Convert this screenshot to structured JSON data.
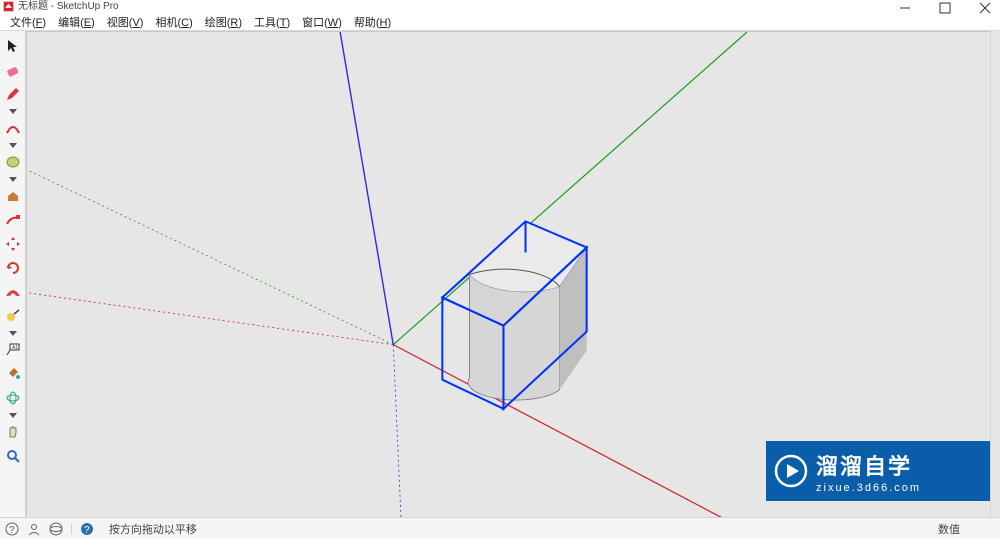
{
  "title": "无标题 - SketchUp Pro",
  "window_controls": {
    "min": "minimize",
    "max": "restore",
    "close": "close"
  },
  "menu": [
    {
      "label": "文件",
      "mn": "F"
    },
    {
      "label": "编辑",
      "mn": "E"
    },
    {
      "label": "视图",
      "mn": "V"
    },
    {
      "label": "相机",
      "mn": "C"
    },
    {
      "label": "绘图",
      "mn": "R"
    },
    {
      "label": "工具",
      "mn": "T"
    },
    {
      "label": "窗口",
      "mn": "W"
    },
    {
      "label": "帮助",
      "mn": "H"
    }
  ],
  "tools": [
    "select-cursor",
    "eraser",
    "pencil",
    "dropdown",
    "arc",
    "dropdown",
    "shape-circle",
    "dropdown",
    "push-pull",
    "follow-me",
    "move",
    "rotate",
    "offset",
    "tape-measure",
    "dropdown",
    "text-label",
    "paint-bucket",
    "orbit",
    "dropdown",
    "pan-hand",
    "zoom"
  ],
  "viewport": {
    "axes": {
      "blue": "#2d2be0",
      "red": "#cf2121",
      "green": "#1f9b1f"
    },
    "selection_color": "#0030ff",
    "background": "#e6e6e6"
  },
  "watermark": {
    "brand": "溜溜自学",
    "url": "zixue.3d66.com"
  },
  "statusbar": {
    "tip": "按方向拖动以平移",
    "right_label": "数值"
  }
}
